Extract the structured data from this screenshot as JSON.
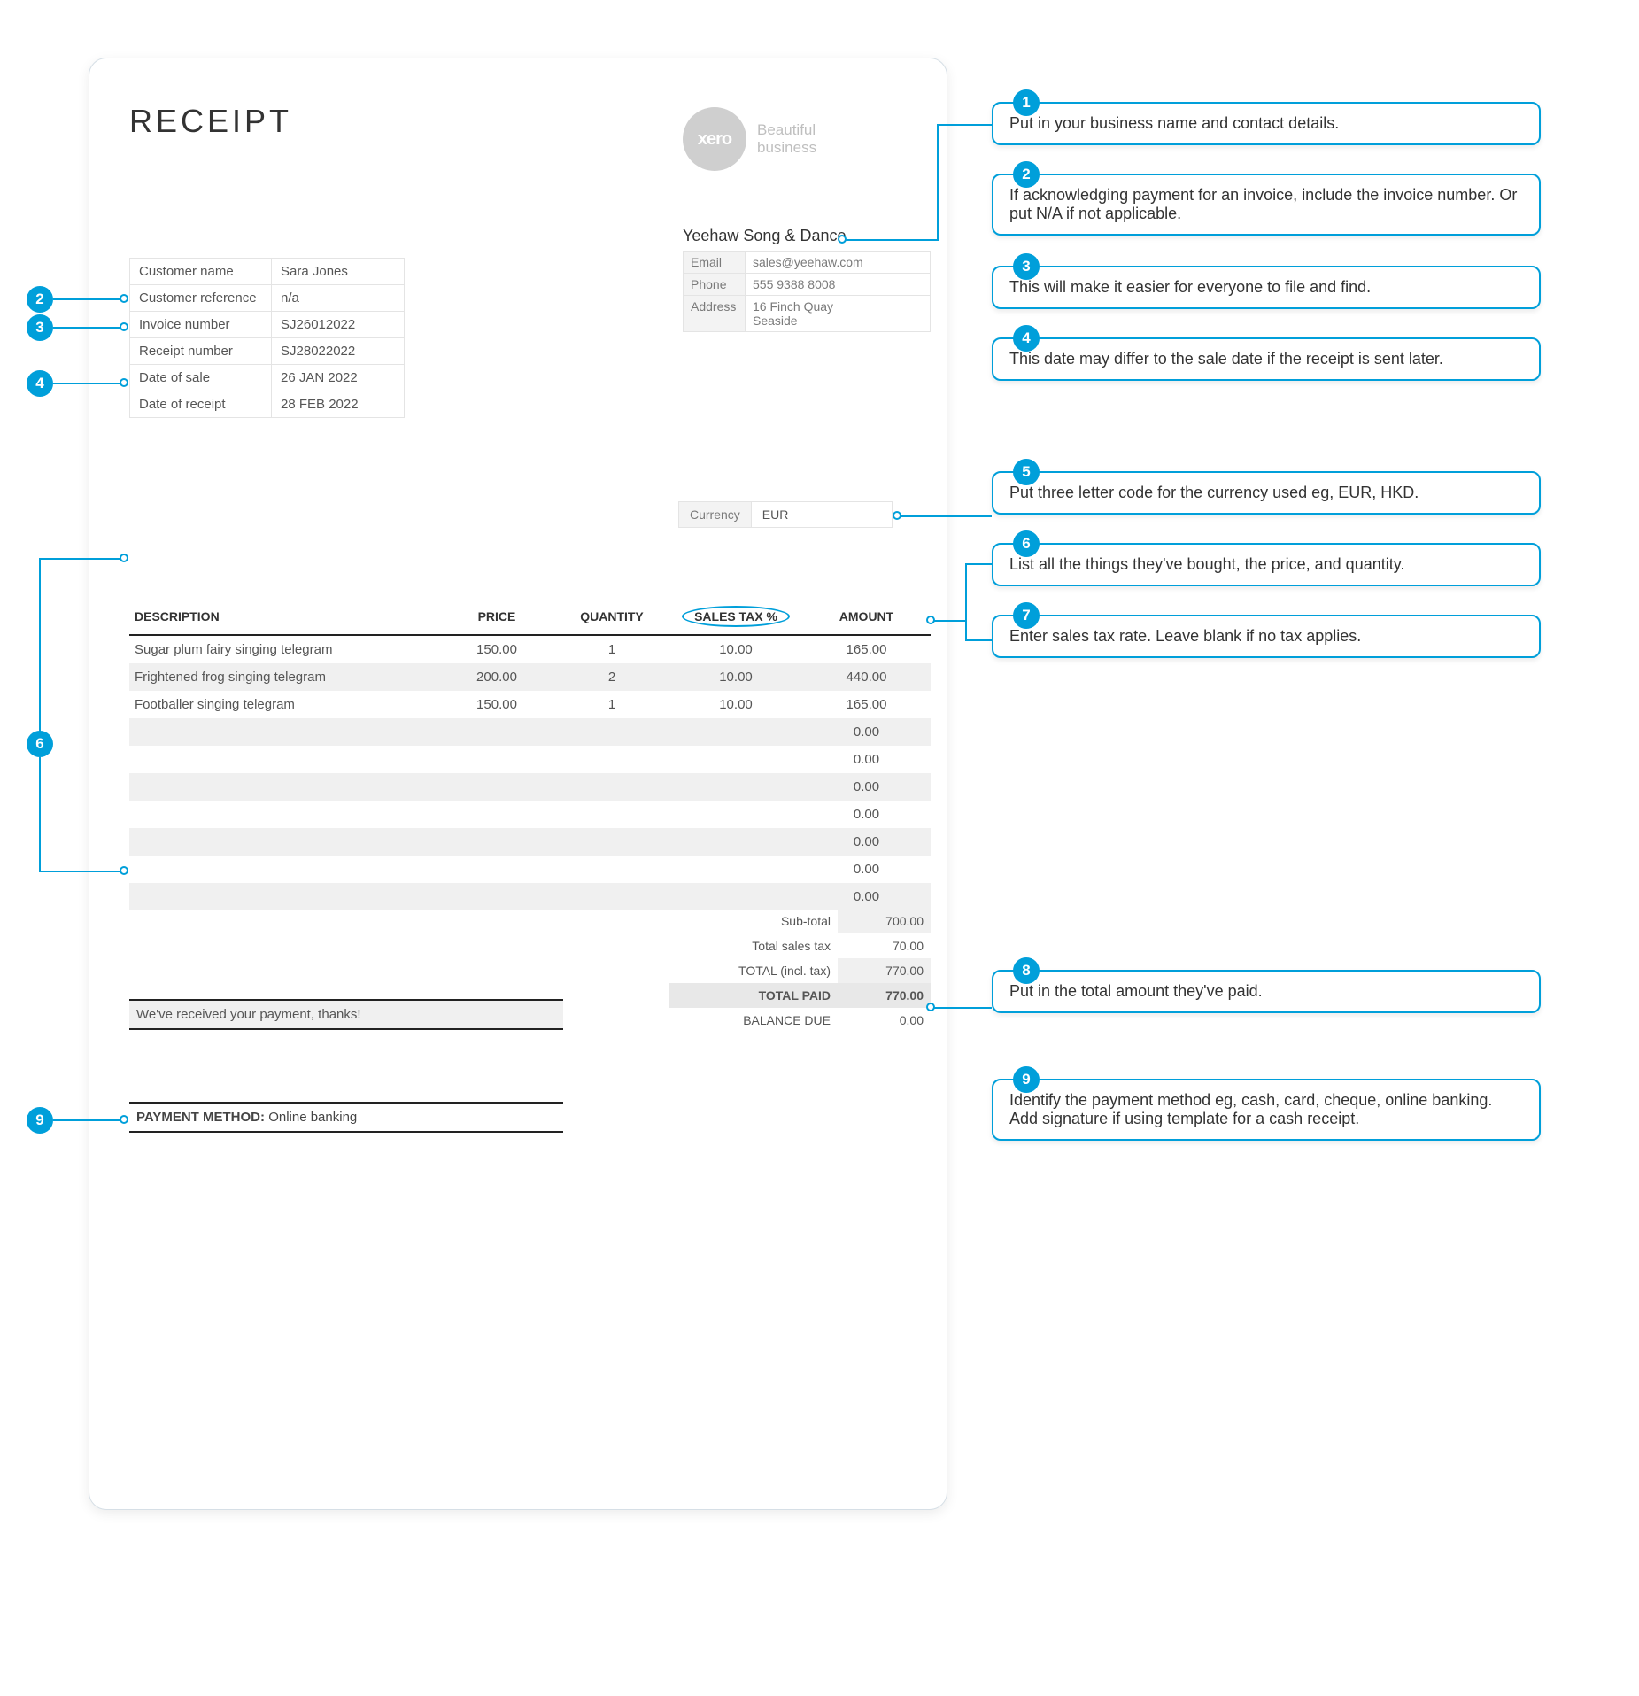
{
  "title": "RECEIPT",
  "logo": {
    "brand": "xero",
    "tag1": "Beautiful",
    "tag2": "business"
  },
  "company": {
    "name": "Yeehaw Song & Dance",
    "email_label": "Email",
    "email": "sales@yeehaw.com",
    "phone_label": "Phone",
    "phone": "555 9388 8008",
    "address_label": "Address",
    "address1": "16 Finch Quay",
    "address2": "Seaside"
  },
  "customer": {
    "rows": [
      {
        "label": "Customer name",
        "value": "Sara Jones"
      },
      {
        "label": "Customer reference",
        "value": "n/a"
      },
      {
        "label": "Invoice number",
        "value": "SJ26012022"
      },
      {
        "label": "Receipt number",
        "value": "SJ28022022"
      },
      {
        "label": "Date of sale",
        "value": "26 JAN 2022"
      },
      {
        "label": "Date of receipt",
        "value": "28 FEB 2022"
      }
    ]
  },
  "currency": {
    "label": "Currency",
    "value": "EUR"
  },
  "items": {
    "headers": {
      "desc": "DESCRIPTION",
      "price": "PRICE",
      "qty": "QUANTITY",
      "tax": "SALES TAX %",
      "amt": "AMOUNT"
    },
    "rows": [
      {
        "desc": "Sugar plum fairy singing telegram",
        "price": "150.00",
        "qty": "1",
        "tax": "10.00",
        "amt": "165.00"
      },
      {
        "desc": "Frightened frog singing telegram",
        "price": "200.00",
        "qty": "2",
        "tax": "10.00",
        "amt": "440.00"
      },
      {
        "desc": "Footballer singing telegram",
        "price": "150.00",
        "qty": "1",
        "tax": "10.00",
        "amt": "165.00"
      },
      {
        "desc": "",
        "price": "",
        "qty": "",
        "tax": "",
        "amt": "0.00"
      },
      {
        "desc": "",
        "price": "",
        "qty": "",
        "tax": "",
        "amt": "0.00"
      },
      {
        "desc": "",
        "price": "",
        "qty": "",
        "tax": "",
        "amt": "0.00"
      },
      {
        "desc": "",
        "price": "",
        "qty": "",
        "tax": "",
        "amt": "0.00"
      },
      {
        "desc": "",
        "price": "",
        "qty": "",
        "tax": "",
        "amt": "0.00"
      },
      {
        "desc": "",
        "price": "",
        "qty": "",
        "tax": "",
        "amt": "0.00"
      },
      {
        "desc": "",
        "price": "",
        "qty": "",
        "tax": "",
        "amt": "0.00"
      },
      {
        "desc": "",
        "price": "",
        "qty": "",
        "tax": "",
        "amt": "0.00"
      }
    ]
  },
  "totals": {
    "subtotal_label": "Sub-total",
    "subtotal": "700.00",
    "taxtotal_label": "Total sales tax",
    "taxtotal": "70.00",
    "incl_label": "TOTAL (incl. tax)",
    "incl": "770.00",
    "paid_label": "TOTAL PAID",
    "paid": "770.00",
    "balance_label": "BALANCE DUE",
    "balance": "0.00"
  },
  "thanks": "We've received your payment, thanks!",
  "payment": {
    "label": "PAYMENT METHOD:",
    "value": "Online banking"
  },
  "callouts": {
    "c1": "Put in your business name and contact details.",
    "c2": "If acknowledging payment for an invoice, include the invoice number. Or put N/A if not applicable.",
    "c3": "This will make it easier for everyone to file and find.",
    "c4": "This date may differ to the sale date if the receipt is sent later.",
    "c5": "Put three letter code for the currency used eg, EUR, HKD.",
    "c6": "List all the things they've bought, the price, and quantity.",
    "c7": "Enter sales tax rate. Leave blank if no tax applies.",
    "c8": "Put in the total amount they've paid.",
    "c9": "Identify the payment method eg, cash, card, cheque, online banking. Add signature if using template for a cash receipt."
  },
  "badges": {
    "b1": "1",
    "b2": "2",
    "b3": "3",
    "b4": "4",
    "b5": "5",
    "b6": "6",
    "b7": "7",
    "b8": "8",
    "b9": "9"
  }
}
